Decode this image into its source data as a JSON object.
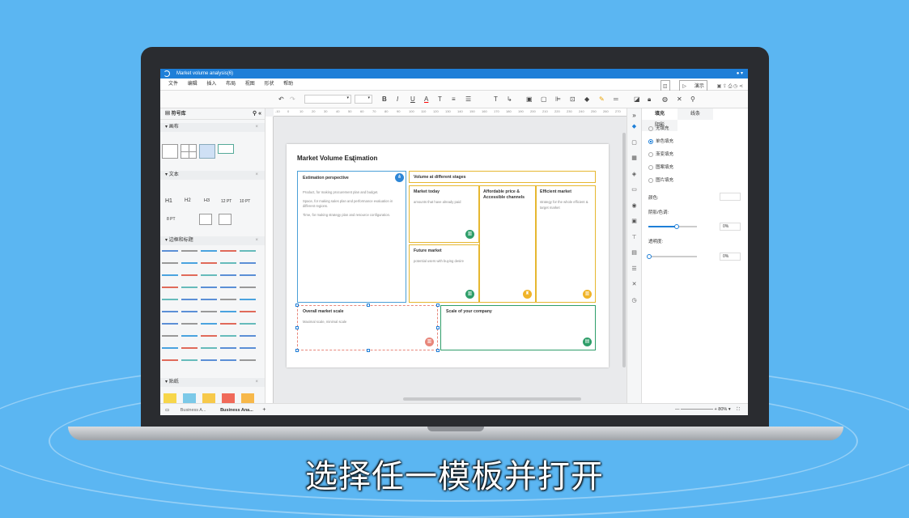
{
  "app": {
    "title": "Market volume analysis(6)"
  },
  "menu": [
    "文件",
    "编辑",
    "插入",
    "布局",
    "视图",
    "形状",
    "帮助"
  ],
  "menu_right": {
    "present": "演示"
  },
  "left_panel": {
    "title": "符号库",
    "sections": [
      "画布",
      "文本",
      "边框和标题",
      "贴纸"
    ],
    "text_samples": [
      "H1",
      "H2",
      "H3",
      "12 PT",
      "10 PT",
      "8 PT"
    ]
  },
  "ruler": [
    "-10",
    "0",
    "10",
    "20",
    "30",
    "40",
    "50",
    "60",
    "70",
    "80",
    "90",
    "100",
    "110",
    "120",
    "130",
    "140",
    "150",
    "160",
    "170",
    "180",
    "190",
    "200",
    "210",
    "220",
    "230",
    "240",
    "250",
    "260",
    "270",
    "280"
  ],
  "diagram": {
    "title": "Market Volume Estimation",
    "estimation": {
      "title": "Estimation perspective",
      "lines": [
        "Product, for making procurement plan and budget.",
        "Space, for making sales plan and performance evaluation in different regions.",
        "Time, for making strategy plan and resource configuration."
      ]
    },
    "volume": {
      "title": "Volume at different stages"
    },
    "market_today": {
      "title": "Market today",
      "text": "amounts that have already paid"
    },
    "affordable": {
      "title": "Affordable price & Accessible channels"
    },
    "efficient": {
      "title": "Efficient market",
      "text": "strategy for the whole efficient & target market"
    },
    "future": {
      "title": "Future market",
      "text": "potential users with buying desire"
    },
    "overall": {
      "title": "Overall market scale",
      "text": "Maximal scale,    minimal scale"
    },
    "company": {
      "title": "Scale of your company"
    }
  },
  "right_panel": {
    "tabs": [
      "填充",
      "线条",
      "阴影"
    ],
    "options": [
      "无填充",
      "单色填充",
      "渐变填充",
      "图案填充",
      "图片填充"
    ],
    "color_label": "颜色:",
    "shade_label": "阴影/色调:",
    "shade_value": "0%",
    "transparency_label": "透明度:",
    "transparency_value": "0%"
  },
  "status": {
    "tabs": [
      "Business A...",
      "Business Ana..."
    ],
    "add": "+",
    "zoom": "80%"
  },
  "subtitle": "选择任一模板并打开"
}
